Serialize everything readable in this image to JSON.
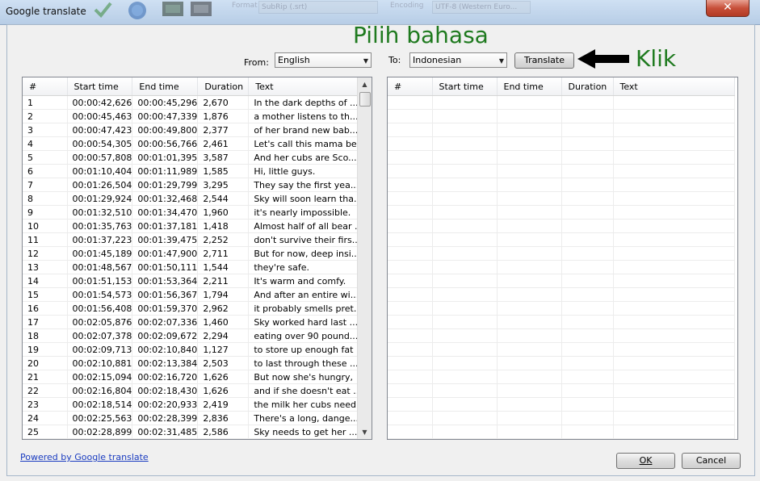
{
  "window": {
    "title": "Google translate",
    "close_symbol": "✕"
  },
  "background_toolbar": {
    "format_label": "Format",
    "format_value": "SubRip (.srt)",
    "encoding_label": "Encoding",
    "encoding_value": "UTF-8 (Western Euro..."
  },
  "annotations": {
    "pilih_bahasa": "Pilih bahasa",
    "klik": "Klik"
  },
  "language_bar": {
    "from_label": "From:",
    "from_value": "English",
    "to_label": "To:",
    "to_value": "Indonesian",
    "translate_label": "Translate"
  },
  "source_grid": {
    "columns": [
      "#",
      "Start time",
      "End time",
      "Duration",
      "Text"
    ],
    "rows": [
      [
        "1",
        "00:00:42,626",
        "00:00:45,296",
        "2,670",
        "In the dark depths of ..."
      ],
      [
        "2",
        "00:00:45,463",
        "00:00:47,339",
        "1,876",
        "a mother listens to th..."
      ],
      [
        "3",
        "00:00:47,423",
        "00:00:49,800",
        "2,377",
        "of her brand new bab..."
      ],
      [
        "4",
        "00:00:54,305",
        "00:00:56,766",
        "2,461",
        "Let's call this mama be..."
      ],
      [
        "5",
        "00:00:57,808",
        "00:01:01,395",
        "3,587",
        "And her cubs are Sco..."
      ],
      [
        "6",
        "00:01:10,404",
        "00:01:11,989",
        "1,585",
        "Hi, little guys."
      ],
      [
        "7",
        "00:01:26,504",
        "00:01:29,799",
        "3,295",
        "They say the first yea..."
      ],
      [
        "8",
        "00:01:29,924",
        "00:01:32,468",
        "2,544",
        "Sky will soon learn tha..."
      ],
      [
        "9",
        "00:01:32,510",
        "00:01:34,470",
        "1,960",
        "it's nearly impossible."
      ],
      [
        "10",
        "00:01:35,763",
        "00:01:37,181",
        "1,418",
        "Almost half of all bear ..."
      ],
      [
        "11",
        "00:01:37,223",
        "00:01:39,475",
        "2,252",
        "don't survive their firs..."
      ],
      [
        "12",
        "00:01:45,189",
        "00:01:47,900",
        "2,711",
        "But for now, deep insi..."
      ],
      [
        "13",
        "00:01:48,567",
        "00:01:50,111",
        "1,544",
        "they're safe."
      ],
      [
        "14",
        "00:01:51,153",
        "00:01:53,364",
        "2,211",
        "It's warm and comfy."
      ],
      [
        "15",
        "00:01:54,573",
        "00:01:56,367",
        "1,794",
        "And after an entire wi..."
      ],
      [
        "16",
        "00:01:56,408",
        "00:01:59,370",
        "2,962",
        "it probably smells pret..."
      ],
      [
        "17",
        "00:02:05,876",
        "00:02:07,336",
        "1,460",
        "Sky worked hard last ..."
      ],
      [
        "18",
        "00:02:07,378",
        "00:02:09,672",
        "2,294",
        "eating over 90 pound..."
      ],
      [
        "19",
        "00:02:09,713",
        "00:02:10,840",
        "1,127",
        "to store up enough fat"
      ],
      [
        "20",
        "00:02:10,881",
        "00:02:13,384",
        "2,503",
        "to last through these ..."
      ],
      [
        "21",
        "00:02:15,094",
        "00:02:16,720",
        "1,626",
        "But now she's hungry,"
      ],
      [
        "22",
        "00:02:16,804",
        "00:02:18,430",
        "1,626",
        "and if she doesn't eat ..."
      ],
      [
        "23",
        "00:02:18,514",
        "00:02:20,933",
        "2,419",
        "the milk her cubs need..."
      ],
      [
        "24",
        "00:02:25,563",
        "00:02:28,399",
        "2,836",
        "There's a long, dange..."
      ],
      [
        "25",
        "00:02:28,899",
        "00:02:31,485",
        "2,586",
        "Sky needs to get her ..."
      ]
    ]
  },
  "target_grid": {
    "columns": [
      "#",
      "Start time",
      "End time",
      "Duration",
      "Text"
    ]
  },
  "footer": {
    "powered_by": "Powered by Google translate",
    "ok_label": "OK",
    "cancel_label": "Cancel"
  },
  "colors": {
    "annotation_green": "#1f7a1f",
    "link_blue": "#1a3cc0"
  }
}
